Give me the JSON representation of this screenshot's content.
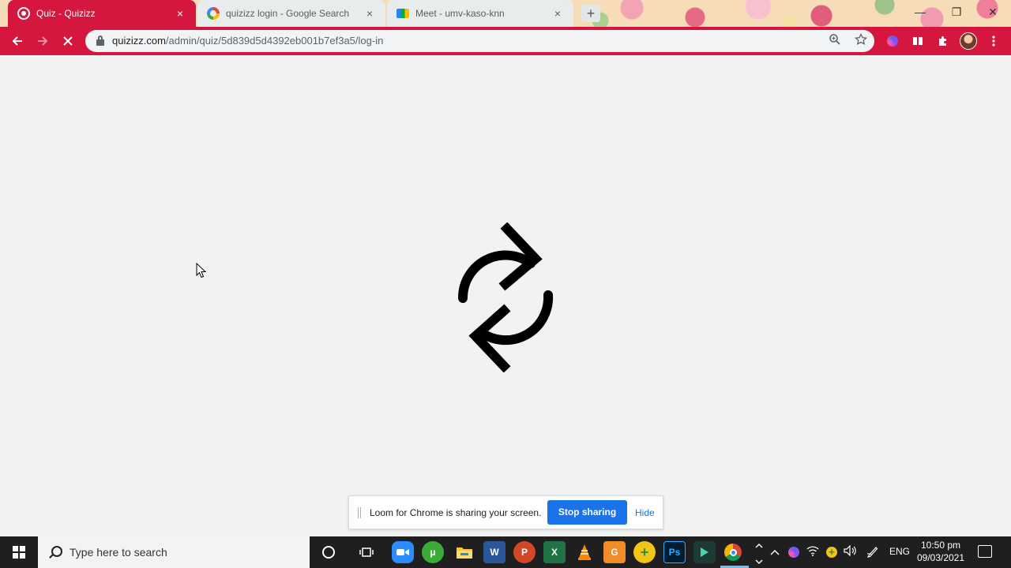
{
  "browser": {
    "tabs": [
      {
        "title": "Quiz - Quizizz",
        "icon": "quizizz-icon",
        "active": true
      },
      {
        "title": "quizizz login - Google Search",
        "icon": "google-icon",
        "active": false
      },
      {
        "title": "Meet - umv-kaso-knn",
        "icon": "google-meet-icon",
        "active": false
      }
    ],
    "close_glyph": "×",
    "new_tab_glyph": "+",
    "window_controls": {
      "minimize": "—",
      "restore": "❐",
      "close": "✕"
    },
    "url_host": "quizizz.com",
    "url_path": "/admin/quiz/5d839d5d4392eb001b7ef3a5/log-in",
    "theme_color": "#d5163e"
  },
  "loom_banner": {
    "message": "Loom for Chrome is sharing your screen.",
    "stop_label": "Stop sharing",
    "hide_label": "Hide",
    "accent": "#1a73e8"
  },
  "taskbar": {
    "search_placeholder": "Type here to search",
    "language": "ENG",
    "time": "10:50 pm",
    "date": "09/03/2021"
  }
}
